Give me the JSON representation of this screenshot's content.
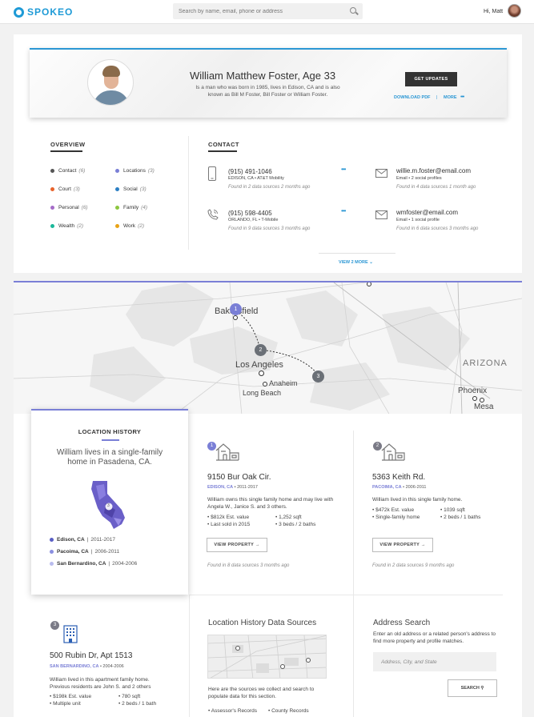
{
  "header": {
    "logo": "SPOKEO",
    "search_placeholder": "Search by name, email, phone or address",
    "greeting": "Hi, Matt"
  },
  "profile": {
    "name": "William Matthew Foster, Age 33",
    "description": "Is a man who was born in 1985, lives in Edison, CA and is also known as Bill M Foster, Bill Foster or William Foster.",
    "get_updates": "GET UPDATES",
    "download_pdf": "DOWNLOAD PDF",
    "separator": "|",
    "more": "MORE",
    "more_dots": "•••"
  },
  "overview": {
    "title": "OVERVIEW",
    "items": [
      {
        "label": "Contact",
        "count": "(6)",
        "color": "#555555"
      },
      {
        "label": "Locations",
        "count": "(3)",
        "color": "#7a7fd6"
      },
      {
        "label": "Court",
        "count": "(3)",
        "color": "#e8632b"
      },
      {
        "label": "Social",
        "count": "(3)",
        "color": "#2b7fc4"
      },
      {
        "label": "Personal",
        "count": "(6)",
        "color": "#a56cc8"
      },
      {
        "label": "Family",
        "count": "(4)",
        "color": "#8cc63f"
      },
      {
        "label": "Wealth",
        "count": "(2)",
        "color": "#1bb89a"
      },
      {
        "label": "Work",
        "count": "(2)",
        "color": "#e8a317"
      }
    ]
  },
  "contact": {
    "title": "CONTACT",
    "phones": [
      {
        "number": "(915) 491-1046",
        "detail": "EDISON, CA  •  AT&T Mobility",
        "found": "Found in 2 data sources 2 months ago",
        "dots": "•••"
      },
      {
        "number": "(915) 598-4405",
        "detail": "ORLANDO, FL  •  T-Mobile",
        "found": "Found in 9 data sources 3 months ago",
        "dots": "•••"
      }
    ],
    "emails": [
      {
        "address": "willie.m.foster@email.com",
        "detail": "Email  •  2 social profiles",
        "found": "Found in 4 data sources 1 month ago"
      },
      {
        "address": "wmfoster@email.com",
        "detail": "Email  •  1 social profile",
        "found": "Found in 6 data sources 3 months ago"
      }
    ],
    "view_more": "VIEW 2 MORE"
  },
  "map": {
    "labels": {
      "bakersfield": "Bakersfield",
      "los_angeles": "Los Angeles",
      "anaheim": "Anaheim",
      "long_beach": "Long Beach",
      "arizona": "ARIZONA",
      "phoenix": "Phoenix",
      "mesa": "Mesa"
    },
    "markers": [
      "1",
      "2",
      "3"
    ]
  },
  "location_history": {
    "title": "LOCATION HISTORY",
    "description": "William lives in a single-family home in Pasadena, CA.",
    "map_marker": "3",
    "entries": [
      {
        "city": "Edison, CA",
        "sep": "|",
        "years": "2011-2017",
        "color": "#5a5fc4"
      },
      {
        "city": "Pacoima, CA",
        "sep": "|",
        "years": "2006-2011",
        "color": "#8a8fe0"
      },
      {
        "city": "San Bernardino, CA",
        "sep": "|",
        "years": "2004-2006",
        "color": "#b9bcee"
      }
    ]
  },
  "properties": [
    {
      "num": "1",
      "address": "9150 Bur Oak Cir.",
      "city": "EDISON, CA",
      "years": "2011-2017",
      "description": "William owns this single family home and may live with Angela W., Janice S. and 3 others.",
      "details": [
        "• $812k Est. value",
        "• 1,252 sqft",
        "• Last sold in 2015",
        "• 3 beds / 2 baths"
      ],
      "button": "VIEW PROPERTY",
      "found": "Found in 8 data sources 3 months ago",
      "color": "#7a7fd6"
    },
    {
      "num": "2",
      "address": "5363 Keith Rd.",
      "city": "PACOIMA, CA",
      "years": "2006-2011",
      "description": "William lived in this single family home.",
      "details": [
        "• $472k Est. value",
        "• 1039 sqft",
        "• Single-family home",
        "• 2 beds / 1 baths"
      ],
      "button": "VIEW PROPERTY",
      "found": "Found in 2 data sources 9 months ago",
      "color": "#7a7a86"
    },
    {
      "num": "3",
      "address": "500 Rubin Dr, Apt 1513",
      "city": "SAN BERNARDINO, CA",
      "years": "2004-2006",
      "description": "William lived in this apartment family home. Previous residents are John S. and 2 others",
      "details": [
        "• $198k Est. value",
        "• 780 sqft",
        "• Multiple unit",
        "• 2 beds / 1 bath"
      ],
      "color": "#7a7a86"
    }
  ],
  "data_sources": {
    "title": "Location History Data Sources",
    "text": "Here are the sources we collect and search to populate data for this section.",
    "items": [
      "• Assessor's Records",
      "• County Records"
    ]
  },
  "address_search": {
    "title": "Address Search",
    "text": "Enter an old address or a related person's address to find more property and profile matches.",
    "placeholder": "Address, City, and State",
    "button": "SEARCH"
  }
}
